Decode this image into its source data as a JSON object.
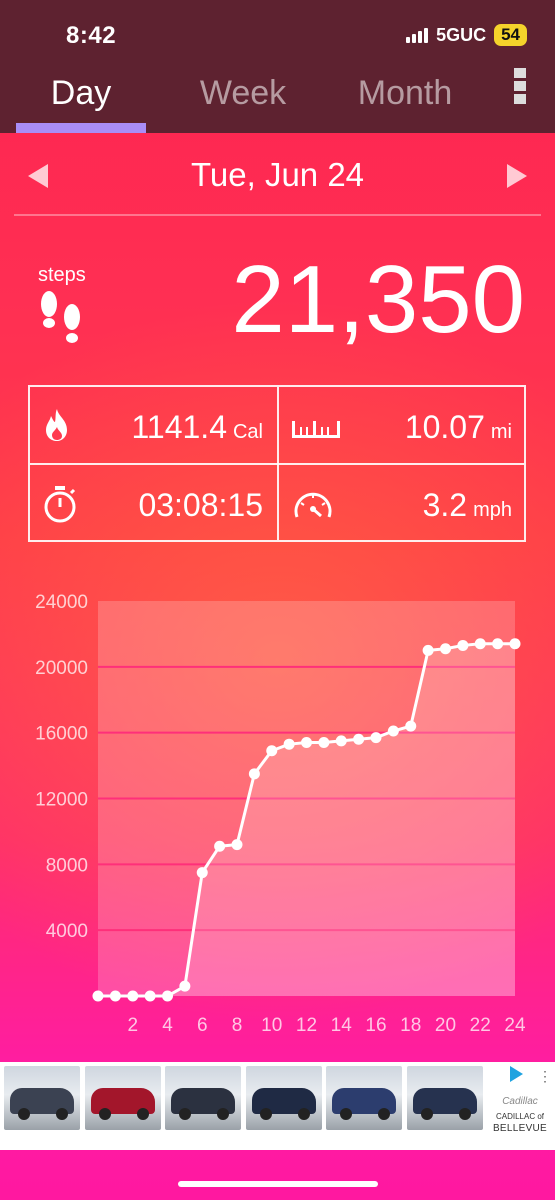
{
  "status_bar": {
    "time": "8:42",
    "network": "5GUC",
    "battery": "54"
  },
  "tabs": [
    {
      "label": "Day",
      "active": true
    },
    {
      "label": "Week",
      "active": false
    },
    {
      "label": "Month",
      "active": false
    }
  ],
  "date": {
    "label": "Tue, Jun 24"
  },
  "steps": {
    "label": "steps",
    "value": "21,350"
  },
  "metrics": {
    "calories": {
      "value": "1141.4",
      "unit": "Cal"
    },
    "distance": {
      "value": "10.07",
      "unit": "mi"
    },
    "duration": {
      "value": "03:08:15",
      "unit": ""
    },
    "speed": {
      "value": "3.2",
      "unit": "mph"
    }
  },
  "chart_data": {
    "type": "line",
    "x": [
      0,
      1,
      2,
      3,
      4,
      5,
      6,
      7,
      8,
      9,
      10,
      11,
      12,
      13,
      14,
      15,
      16,
      17,
      18,
      19,
      20,
      21,
      22,
      23,
      24
    ],
    "values": [
      0,
      0,
      0,
      0,
      0,
      600,
      7500,
      9100,
      9200,
      13500,
      14900,
      15300,
      15400,
      15400,
      15500,
      15600,
      15700,
      16100,
      16400,
      21000,
      21100,
      21300,
      21400,
      21400,
      21400
    ],
    "xticks": [
      "2",
      "4",
      "6",
      "8",
      "10",
      "12",
      "14",
      "16",
      "18",
      "20",
      "22",
      "24"
    ],
    "yticks": [
      "4000",
      "8000",
      "12000",
      "16000",
      "20000",
      "24000"
    ],
    "ylim": [
      0,
      24000
    ],
    "xlim": [
      0,
      24
    ],
    "colors": {
      "line": "#ffffff",
      "grid": "#ff2f7a"
    }
  },
  "ad": {
    "brand_logo": "Cadillac",
    "line1": "CADILLAC of",
    "line2": "BELLEVUE"
  }
}
